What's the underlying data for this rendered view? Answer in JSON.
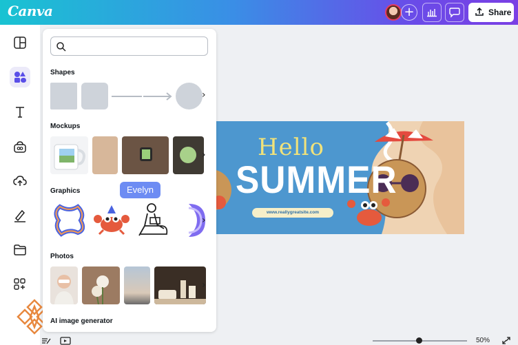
{
  "app": {
    "logo": "Canva"
  },
  "toolbar": {
    "share_label": "Share",
    "add_label": "+"
  },
  "search": {
    "placeholder": ""
  },
  "sections": [
    {
      "title": "Shapes"
    },
    {
      "title": "Mockups"
    },
    {
      "title": "Graphics"
    },
    {
      "title": "Photos"
    },
    {
      "title": "AI image generator"
    }
  ],
  "collaborator": {
    "name": "Evelyn"
  },
  "design": {
    "headline_1": "Hello",
    "headline_2": "SUMMER",
    "website": "www.reallygreatsite.com"
  },
  "footer": {
    "zoom": "50%"
  },
  "colors": {
    "accent": "#7d2ae8",
    "banner": "#4d97cf",
    "tooltip": "#6d8cf3"
  },
  "zoom_slider": {
    "value_percent": 50
  }
}
